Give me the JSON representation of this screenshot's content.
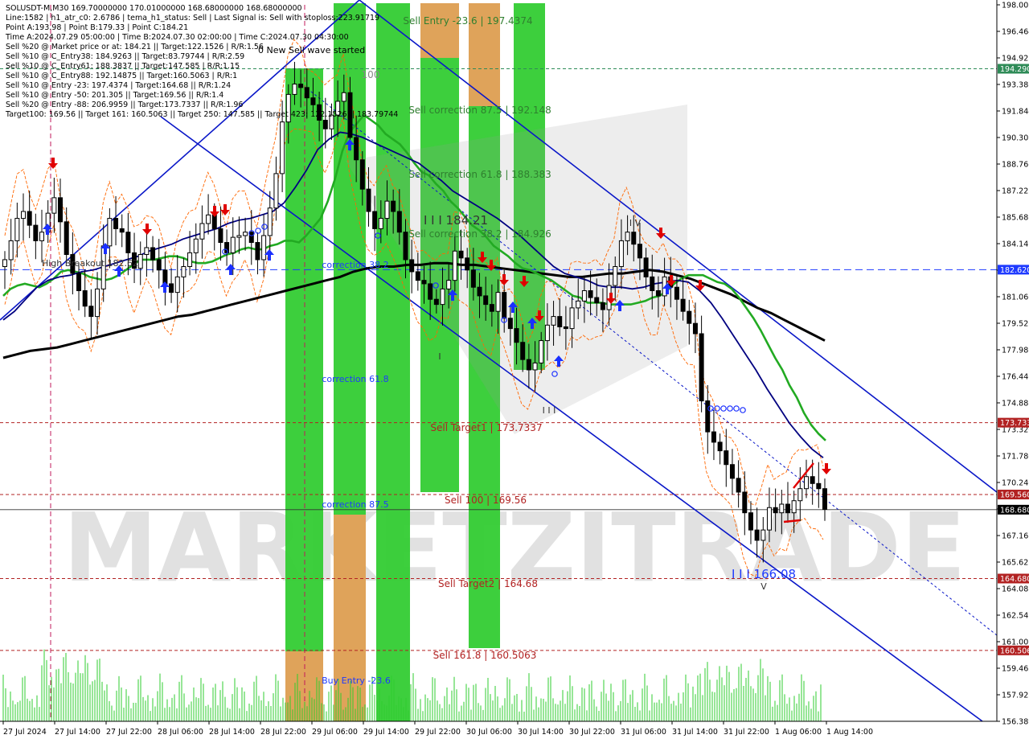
{
  "header": {
    "info_lines": [
      "SOLUSDT-M,M30  169.70000000 170.01000000 168.68000000 168.68000000",
      "Line:1582 | h1_atr_c0: 2.6786 | tema_h1_status: Sell | Last Signal is: Sell with stoploss:223.91719",
      "Point A:193.98 | Point B:179.33 | Point C:184.21",
      "Time A:2024.07.29 05:00:00 | Time B:2024.07.30 02:00:00 | Time C:2024.07.30 04:30:00",
      "Sell %20 @ Market price or at: 184.21 || Target:122.1526 | R/R:1.56",
      "Sell %10 @ C_Entry38: 184.9263 || Target:83.79744 | R/R:2.59",
      "Sell %10 @ C_Entry61: 188.3837 || Target:147.585 | R/R:1.15",
      "Sell %10 @ C_Entry88: 192.14875 || Target:160.5063 | R/R:1",
      "Sell %10 @ Entry -23: 197.4374 | Target:164.68 || R/R:1.24",
      "Sell %10 @ Entry -50: 201.305 || Target:169.56 || R/R:1.4",
      "Sell %20 @ Entry -88: 206.9959 || Target:173.7337 || R/R:1.96",
      "Target100: 169.56 || Target 161: 160.5063 || Target 250: 147.585 || Target 423: 122.1526 || 183.79744"
    ],
    "wave_label": "0 New Sell wave started"
  },
  "watermark": "MARKETZITRADE",
  "chart_data": {
    "type": "candlestick",
    "symbol": "SOLUSDT-M",
    "timeframe": "M30",
    "ohlc_last": {
      "open": 169.7,
      "high": 170.01,
      "low": 168.68,
      "close": 168.68
    },
    "y_axis": {
      "ylim": [
        156.389,
        198.003
      ],
      "tick_labels": [
        "198.003",
        "196.464",
        "194.925",
        "193.386",
        "191.844",
        "190.305",
        "188.766",
        "187.225",
        "185.686",
        "184.147",
        "182.620",
        "181.066",
        "179.526",
        "177.986",
        "176.440",
        "174.886",
        "173.320",
        "171.780",
        "170.240",
        "168.680",
        "167.161",
        "165.621",
        "164.081",
        "162.541",
        "161.002",
        "159.462",
        "157.923",
        "156.389"
      ]
    },
    "x_axis": {
      "tick_labels": [
        "27 Jul 2024",
        "27 Jul 14:00",
        "27 Jul 22:00",
        "28 Jul 06:00",
        "28 Jul 14:00",
        "28 Jul 22:00",
        "29 Jul 06:00",
        "29 Jul 14:00",
        "29 Jul 22:00",
        "30 Jul 06:00",
        "30 Jul 14:00",
        "30 Jul 22:00",
        "31 Jul 06:00",
        "31 Jul 14:00",
        "31 Jul 22:00",
        "1 Aug 06:00",
        "1 Aug 14:00"
      ]
    },
    "close_series": [
      183.2,
      184.3,
      185.6,
      186.0,
      185.2,
      184.3,
      184.8,
      185.9,
      186.8,
      185.4,
      183.5,
      182.4,
      181.4,
      180.5,
      179.9,
      181.5,
      184.0,
      185.6,
      185.0,
      184.8,
      183.6,
      182.7,
      183.5,
      183.9,
      183.2,
      182.6,
      181.8,
      181.3,
      182.2,
      182.8,
      183.6,
      184.4,
      185.3,
      185.8,
      185.0,
      184.2,
      183.6,
      184.5,
      184.6,
      184.8,
      184.2,
      183.2,
      184.6,
      186.2,
      188.2,
      191.2,
      192.8,
      193.4,
      193.2,
      192.6,
      192.2,
      191.3,
      190.8,
      191.6,
      192.4,
      192.9,
      190.3,
      189.0,
      187.3,
      186.0,
      185.0,
      185.6,
      186.6,
      186.0,
      184.8,
      183.2,
      182.5,
      182.0,
      181.8,
      180.9,
      180.6,
      181.5,
      182.0,
      183.7,
      183.3,
      182.6,
      181.6,
      181.1,
      180.6,
      180.2,
      181.3,
      179.8,
      179.2,
      178.4,
      177.4,
      176.8,
      177.2,
      178.5,
      179.4,
      179.9,
      179.3,
      179.2,
      180.4,
      180.8,
      181.4,
      181.0,
      180.7,
      180.3,
      181.7,
      182.8,
      184.3,
      184.8,
      184.1,
      183.3,
      182.2,
      181.4,
      181.1,
      182.2,
      181.6,
      180.9,
      180.2,
      179.5,
      178.9,
      175.0,
      173.2,
      172.6,
      172.1,
      171.3,
      170.5,
      169.7,
      168.5,
      167.5,
      166.9,
      167.5,
      168.8,
      168.5,
      169.0,
      168.5,
      169.2,
      169.9,
      170.6,
      170.2,
      169.9,
      168.7
    ],
    "overlays": {
      "sma_green_series": [
        181.1,
        181.5,
        181.7,
        181.8,
        181.7,
        181.6,
        181.8,
        182.1,
        182.5,
        182.6,
        182.5,
        182.4,
        182.2,
        182.1,
        182.0,
        182.1,
        182.3,
        182.6,
        182.9,
        183.2,
        183.2,
        183.2,
        183.3,
        183.4,
        183.4,
        183.3,
        183.1,
        183.0,
        183.0,
        183.1,
        183.3,
        183.5,
        183.6,
        183.8,
        183.9,
        183.8,
        183.8,
        184.0,
        184.1,
        184.3,
        184.3,
        184.2,
        184.6,
        185.1,
        185.6,
        186.6,
        187.9,
        189.5,
        190.6,
        191.1,
        191.6,
        191.3,
        191.0,
        190.5,
        190.2,
        189.9,
        189.4,
        188.8,
        188.3,
        188.1,
        187.6,
        187.2,
        186.6,
        186.2,
        185.7,
        185.2,
        184.9,
        184.5,
        184.0,
        183.7,
        183.4,
        183.0,
        182.7,
        182.6,
        182.4,
        182.2,
        182.0,
        181.7,
        181.4,
        181.1,
        181.0,
        180.7,
        180.7,
        180.7,
        180.6,
        180.6,
        180.6,
        180.6,
        180.7,
        180.8,
        181.0,
        181.1,
        181.4,
        181.8,
        182.1,
        182.3,
        182.3,
        182.3,
        182.1,
        181.9,
        181.8,
        181.5,
        181.0,
        180.4,
        179.8,
        179.1,
        178.3,
        177.5,
        176.8,
        175.9,
        175.2,
        174.3,
        173.6,
        173.1,
        172.7
      ],
      "sma_black_series": [
        177.5,
        177.7,
        177.9,
        178.0,
        178.1,
        178.3,
        178.5,
        178.7,
        178.9,
        179.1,
        179.3,
        179.5,
        179.7,
        179.9,
        180.0,
        180.2,
        180.4,
        180.6,
        180.8,
        181.0,
        181.2,
        181.4,
        181.6,
        181.8,
        182.0,
        182.2,
        182.5,
        182.7,
        182.8,
        182.8,
        182.9,
        182.9,
        183.0,
        183.0,
        182.9,
        182.9,
        182.8,
        182.7,
        182.6,
        182.5,
        182.4,
        182.3,
        182.2,
        182.2,
        182.3,
        182.4,
        182.4,
        182.5,
        182.6,
        182.5,
        182.3,
        182.1,
        181.8,
        181.5,
        181.2,
        180.8,
        180.4,
        180.1,
        179.7,
        179.3,
        178.9,
        178.5
      ],
      "sma_navy_series": [
        179.7,
        180.2,
        180.9,
        181.6,
        182.0,
        182.2,
        182.3,
        182.5,
        182.6,
        182.8,
        183.0,
        183.2,
        183.4,
        183.7,
        183.9,
        184.1,
        184.4,
        184.6,
        184.8,
        185.0,
        185.3,
        185.5,
        185.6,
        185.8,
        186.0,
        186.5,
        187.4,
        188.4,
        189.6,
        190.2,
        190.6,
        190.5,
        190.3,
        190.0,
        189.7,
        189.4,
        189.1,
        188.8,
        188.3,
        187.8,
        187.2,
        186.8,
        186.4,
        186.0,
        185.6,
        185.1,
        184.6,
        184.0,
        183.4,
        182.8,
        182.4,
        182.2,
        182.0,
        181.7,
        181.6,
        181.6,
        181.5,
        181.6,
        181.8,
        181.9,
        182.0,
        181.9,
        181.4,
        180.7,
        179.8,
        178.8,
        177.8,
        176.8,
        175.7,
        174.7,
        173.7,
        172.9,
        172.2,
        171.7
      ],
      "levels": [
        {
          "label": "Sell Target1 | 173.7337",
          "price": 173.7337,
          "axis_label": "173.733",
          "color": "#b22222"
        },
        {
          "label": "Sell 100 | 169.56",
          "price": 169.56,
          "axis_label": "169.560",
          "color": "#b22222"
        },
        {
          "label": "Sell Target2 | 164.68",
          "price": 164.68,
          "axis_label": "164.680",
          "color": "#b22222"
        },
        {
          "label": "Sell 161.8 | 160.5063",
          "price": 160.5063,
          "axis_label": "160.506",
          "color": "#b22222"
        },
        {
          "label": "",
          "price": 182.62,
          "axis_label": "182.620",
          "color": "#1e3aff"
        },
        {
          "label": "",
          "price": 194.29,
          "axis_label": "194.290",
          "color": "#2e8b57"
        },
        {
          "label": "",
          "price": 168.68,
          "axis_label": "168.680",
          "color": "#333333"
        }
      ],
      "zone_labels": [
        {
          "text": "Sell Entry -23.6 | 197.4374",
          "color": "#2f7f2f"
        },
        {
          "text": "Sell correction 87.5 | 192.148",
          "color": "#2f7f2f"
        },
        {
          "text": "Sell correction 61.8 | 188.383",
          "color": "#2f7f2f"
        },
        {
          "text": "Sell correction 38.2 | 184.926",
          "color": "#2f7f2f"
        },
        {
          "text": "correction 38.2",
          "color": "#1e3aff"
        },
        {
          "text": "correction 61.8",
          "color": "#1e3aff"
        },
        {
          "text": "correction 87.5",
          "color": "#1e3aff"
        },
        {
          "text": "Buy Entry -23.6",
          "color": "#1e3aff"
        },
        {
          "text": "100",
          "color": "#888888"
        },
        {
          "text": "I I I  184.21",
          "color": "#333333"
        },
        {
          "text": "I I I  166.08",
          "color": "#1e3aff"
        },
        {
          "text": "I V",
          "color": "#333333"
        },
        {
          "text": "V",
          "color": "#333333"
        },
        {
          "text": "I",
          "color": "#333333"
        },
        {
          "text": "I I I",
          "color": "#333333"
        },
        {
          "text": "High Breakout 182.62",
          "color": "#333333"
        }
      ],
      "channel_color": "#0a17c8"
    }
  },
  "colors": {
    "bull": "#000000",
    "bear": "#000000",
    "green_zone": "#33cc33",
    "orange_zone": "#e8a05c",
    "sma_green": "#22aa22",
    "sma_black": "#000000",
    "sma_navy": "#000080",
    "envelope": "#ff6600",
    "volume": "#2fcc2f",
    "axis_text": "#000000",
    "price_tag_bg": "#b22222"
  }
}
